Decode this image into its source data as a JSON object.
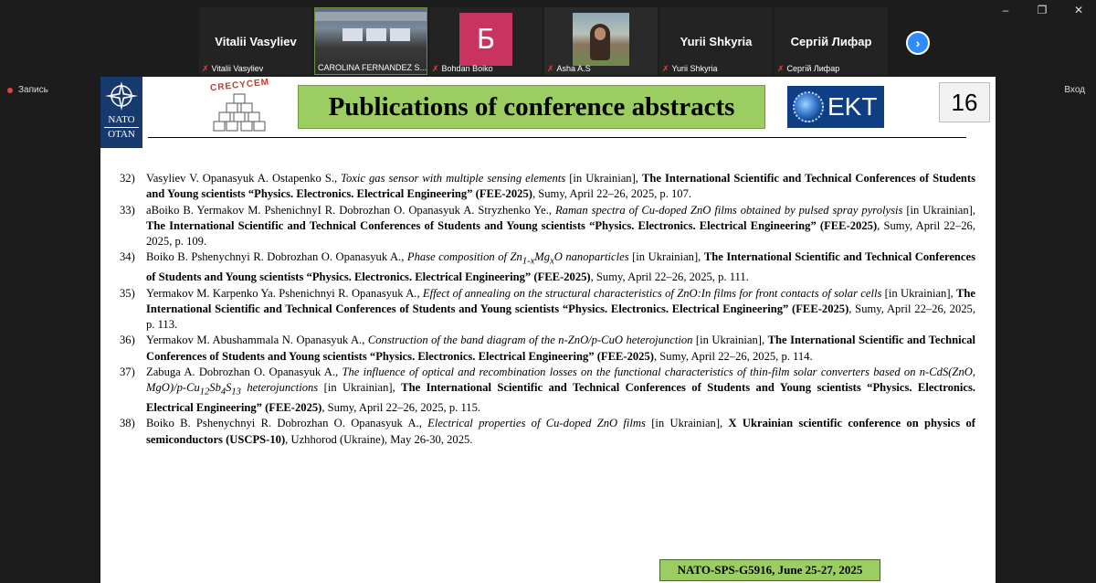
{
  "window_controls": [
    "–",
    "❐",
    "✕"
  ],
  "participants": [
    {
      "display_name": "Vitalii Vasyliev",
      "caption": "Vitalii Vasyliev",
      "type": "name"
    },
    {
      "display_name": "",
      "caption": "CAROLINA FERNANDEZ S...",
      "type": "video"
    },
    {
      "display_name": "Б",
      "caption": "Bohdan Boiko",
      "type": "avatar"
    },
    {
      "display_name": "",
      "caption": "Asha A.S",
      "type": "video"
    },
    {
      "display_name": "Yurii Shkyria",
      "caption": "Yurii Shkyria",
      "type": "name"
    },
    {
      "display_name": "Сергій Лифар",
      "caption": "Сергій Лифар",
      "type": "name"
    }
  ],
  "next_button": "›",
  "record_label": "Запись",
  "enter_label": "Вход",
  "slide": {
    "nato_logo": {
      "line1": "NATO",
      "line2": "OTAN"
    },
    "crecycem_logo": "CRECYCEM",
    "title": "Publications of conference abstracts",
    "ekt_logo": "EKT",
    "slide_number": "16",
    "footer": "NATO-SPS-G5916, June 25-27, 2025",
    "publications": [
      {
        "num": "32)",
        "authors": "Vasyliev V. Opanasyuk A. Ostapenko S., ",
        "title": "Toxic gas sensor with multiple sensing elements",
        "lang": " [in Ukrainian], ",
        "conference": "The International Scientific and Technical Conferences of Students and Young scientists “Physics. Electronics. Electrical Engineering” (FEE-2025)",
        "details": ", Sumy, April 22–26, 2025, p. 107."
      },
      {
        "num": "33)",
        "authors": "aBoiko B. Yermakov M. PshenichnyI R. Dobrozhan O. Opanasyuk A. Stryzhenko Ye., ",
        "title": "Raman spectra of Cu-doped ZnO films obtained by pulsed spray pyrolysis",
        "lang": " [in Ukrainian], ",
        "conference": "The International Scientific and Technical Conferences of Students and Young scientists “Physics. Electronics. Electrical Engineering” (FEE-2025)",
        "details": ", Sumy, April 22–26, 2025, p. 109."
      },
      {
        "num": "34)",
        "authors": "Boiko B. Pshenychnyi R. Dobrozhan O. Opanasyuk A., ",
        "title_html_parts": [
          "Phase composition of Zn",
          "1-x",
          "Mg",
          "x",
          "O nanoparticles"
        ],
        "lang": " [in Ukrainian], ",
        "conference": "The International Scientific and Technical Conferences of Students and Young scientists “Physics. Electronics. Electrical Engineering” (FEE-2025)",
        "details": ", Sumy, April 22–26, 2025, p. 111."
      },
      {
        "num": "35)",
        "authors": "Yermakov M. Karpenko Ya. Pshenichnyi R. Opanasyuk A., ",
        "title": "Effect of annealing on the structural characteristics of ZnO:In films for front contacts of solar cells",
        "lang": " [in Ukrainian], ",
        "conference": "The International Scientific and Technical Conferences of Students and Young scientists “Physics. Electronics. Electrical Engineering” (FEE-2025)",
        "details": ", Sumy, April 22–26, 2025, p. 113."
      },
      {
        "num": "36)",
        "authors": "Yermakov M. Abushammala N. Opanasyuk A., ",
        "title": "Construction of the band diagram of the n-ZnO/p-CuO heterojunction",
        "lang": " [in Ukrainian], ",
        "conference": "The International Scientific and Technical Conferences of Students and Young scientists “Physics. Electronics. Electrical Engineering” (FEE-2025)",
        "details": ", Sumy, April 22–26, 2025, p. 114."
      },
      {
        "num": "37)",
        "authors": "Zabuga A. Dobrozhan O. Opanasyuk A., ",
        "title_html_parts": [
          "The influence of optical and recombination losses on the functional characteristics of thin-film solar converters based on n-CdS(ZnO, MgO)/p-Cu",
          "12",
          "Sb",
          "4",
          "S",
          "13",
          " heterojunctions"
        ],
        "lang": " [in Ukrainian], ",
        "conference": "The International Scientific and Technical Conferences of Students and Young scientists “Physics. Electronics. Electrical Engineering” (FEE-2025)",
        "details": ", Sumy, April 22–26, 2025, p. 115."
      },
      {
        "num": "38)",
        "authors": "Boiko B. Pshenychnyi R. Dobrozhan O. Opanasyuk A., ",
        "title": "Electrical properties of Cu-doped ZnO films",
        "lang": " [in Ukrainian], ",
        "conference": "X Ukrainian scientific conference on physics of semiconductors (USCPS-10)",
        "details": ", Uzhhorod (Ukraine), May 26-30, 2025."
      }
    ]
  }
}
